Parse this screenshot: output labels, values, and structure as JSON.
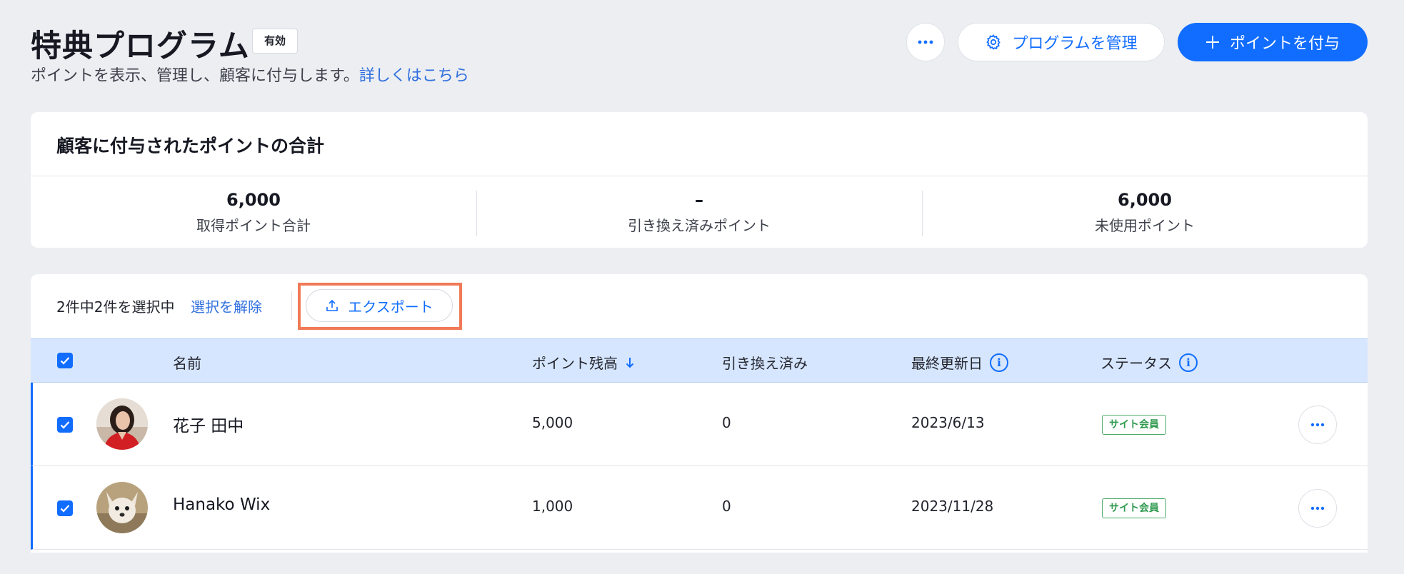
{
  "header": {
    "title": "特典プログラム",
    "status_badge": "有効",
    "subtitle": "ポイントを表示、管理し、顧客に付与します。",
    "learn_more": "詳しくはこちら",
    "more_icon": "ellipsis-icon",
    "manage_label": "プログラムを管理",
    "manage_icon": "gear-icon",
    "award_label": "ポイントを付与",
    "award_icon": "plus-icon"
  },
  "summary": {
    "title": "顧客に付与されたポイントの合計",
    "stats": [
      {
        "value": "6,000",
        "label": "取得ポイント合計"
      },
      {
        "value": "–",
        "label": "引き換え済みポイント"
      },
      {
        "value": "6,000",
        "label": "未使用ポイント"
      }
    ]
  },
  "toolbar": {
    "selection_text": "2件中2件を選択中",
    "clear_selection": "選択を解除",
    "export_label": "エクスポート",
    "export_icon": "upload-icon"
  },
  "table": {
    "columns": {
      "name": "名前",
      "balance": "ポイント残高",
      "redeemed": "引き換え済み",
      "last_updated": "最終更新日",
      "status": "ステータス"
    },
    "rows": [
      {
        "name": "花子 田中",
        "balance": "5,000",
        "redeemed": "0",
        "last_updated": "2023/6/13",
        "status": "サイト会員"
      },
      {
        "name": "Hanako Wix",
        "balance": "1,000",
        "redeemed": "0",
        "last_updated": "2023/11/28",
        "status": "サイト会員"
      }
    ]
  },
  "colors": {
    "accent": "#116dff",
    "highlight": "#f07a57",
    "status_green": "#2f9a4e",
    "header_row": "#d6e6fe"
  }
}
